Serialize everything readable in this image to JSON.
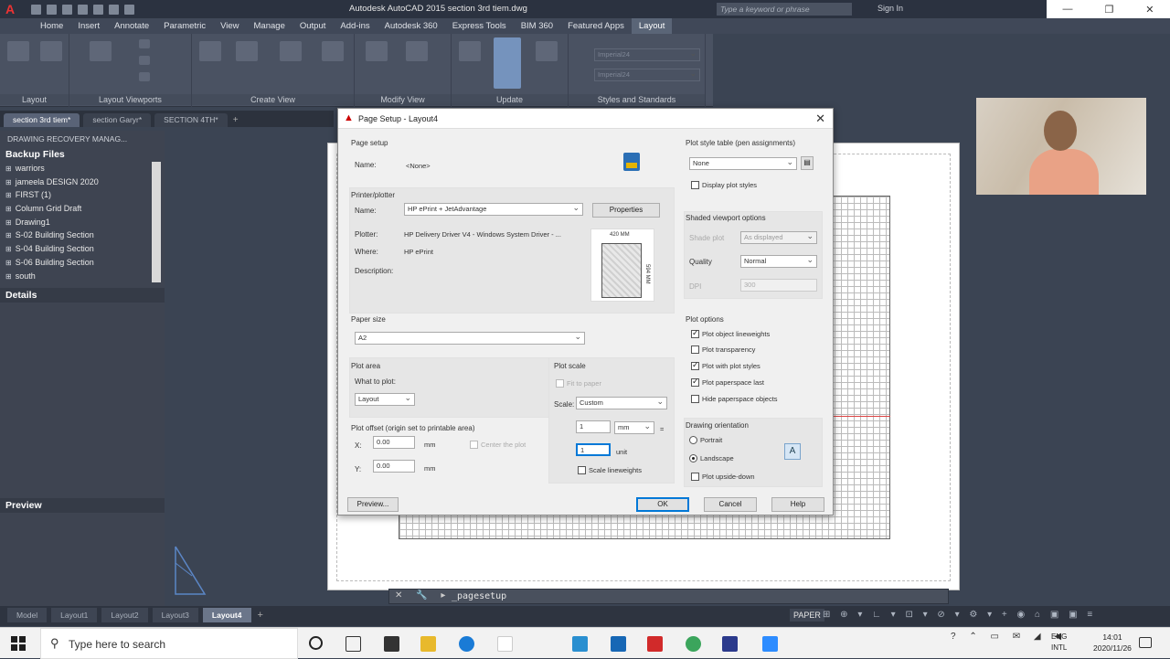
{
  "app": {
    "title": "Autodesk AutoCAD 2015   section 3rd tiem.dwg",
    "search_placeholder": "Type a keyword or phrase",
    "sign_in": "Sign In"
  },
  "ribbon": {
    "tabs": [
      "Home",
      "Insert",
      "Annotate",
      "Parametric",
      "View",
      "Manage",
      "Output",
      "Add-ins",
      "Autodesk 360",
      "Express Tools",
      "BIM 360",
      "Featured Apps",
      "Layout"
    ],
    "active_tab": "Layout",
    "panels": [
      "Layout",
      "Layout Viewports",
      "Create View",
      "Modify View",
      "Update",
      "Styles and Standards"
    ],
    "style_values": [
      "Imperial24",
      "Imperial24"
    ]
  },
  "doc_tabs": [
    "section 3rd tiem*",
    "section Garyr*",
    "SECTION 4TH*"
  ],
  "left_panel": {
    "recovery_title": "DRAWING RECOVERY MANAG...",
    "backup_header": "Backup Files",
    "backup_items": [
      "warriors",
      "jameela DESIGN 2020",
      "FIRST (1)",
      "Column Grid Draft",
      "Drawing1",
      "S-02 Building Section",
      "S-04 Building Section",
      "S-06 Building Section",
      "south"
    ],
    "details": "Details",
    "preview": "Preview"
  },
  "dialog": {
    "title": "Page Setup - Layout4",
    "page_setup": {
      "group": "Page setup",
      "name_label": "Name:",
      "name_value": "<None>"
    },
    "printer": {
      "group": "Printer/plotter",
      "name_label": "Name:",
      "name_value": "HP ePrint + JetAdvantage",
      "properties": "Properties",
      "plotter_label": "Plotter:",
      "plotter_value": "HP Delivery Driver V4 - Windows System Driver - ...",
      "where_label": "Where:",
      "where_value": "HP ePrint",
      "desc_label": "Description:",
      "preview_w": "420 MM",
      "preview_h": "594 MM"
    },
    "paper_size": {
      "group": "Paper size",
      "value": "A2"
    },
    "plot_area": {
      "group": "Plot area",
      "what_label": "What to plot:",
      "what_value": "Layout"
    },
    "plot_offset": {
      "group": "Plot offset (origin set to printable area)",
      "x_label": "X:",
      "x_value": "0.00",
      "y_label": "Y:",
      "y_value": "0.00",
      "unit": "mm",
      "center": "Center the plot"
    },
    "plot_scale": {
      "group": "Plot scale",
      "fit": "Fit to paper",
      "scale_label": "Scale:",
      "scale_value": "Custom",
      "num_value": "1",
      "num_unit": "mm",
      "eq": "=",
      "den_value": "1",
      "den_unit": "unit",
      "lineweights": "Scale lineweights"
    },
    "plot_style": {
      "group": "Plot style table (pen assignments)",
      "value": "None",
      "display": "Display plot styles"
    },
    "shaded": {
      "group": "Shaded viewport options",
      "shade_label": "Shade plot",
      "shade_value": "As displayed",
      "quality_label": "Quality",
      "quality_value": "Normal",
      "dpi_label": "DPI",
      "dpi_value": "300"
    },
    "plot_options": {
      "group": "Plot options",
      "items": [
        {
          "label": "Plot object lineweights",
          "checked": true
        },
        {
          "label": "Plot transparency",
          "checked": false
        },
        {
          "label": "Plot with plot styles",
          "checked": true
        },
        {
          "label": "Plot paperspace last",
          "checked": true
        },
        {
          "label": "Hide paperspace objects",
          "checked": false
        }
      ]
    },
    "orientation": {
      "group": "Drawing orientation",
      "portrait": "Portrait",
      "landscape": "Landscape",
      "upside": "Plot upside-down"
    },
    "buttons": {
      "preview": "Preview...",
      "ok": "OK",
      "cancel": "Cancel",
      "help": "Help"
    }
  },
  "command": {
    "text": "_pagesetup"
  },
  "layout_tabs": [
    "Model",
    "Layout1",
    "Layout2",
    "Layout3",
    "Layout4"
  ],
  "active_layout": "Layout4",
  "status": {
    "paper": "PAPER"
  },
  "taskbar": {
    "search_placeholder": "Type here to search",
    "lang_top": "ENG",
    "lang_bottom": "INTL",
    "time": "14:01",
    "date": "2020/11/26"
  }
}
